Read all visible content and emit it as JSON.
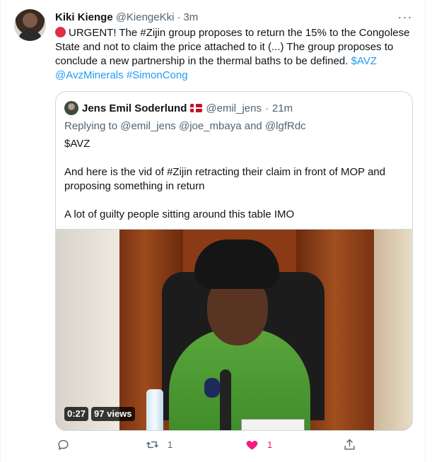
{
  "tweet": {
    "author_name": "Kiki Kienge",
    "author_handle": "@KiengeKki",
    "separator": "·",
    "time": "3m",
    "more_label": "···",
    "text_part1": "URGENT! The #Zijin group  proposes to return the 15% to the Congolese State and not to claim the price attached to it (...) The group proposes to conclude a new partnership in the thermal baths to be defined.",
    "link_cashtag": "$AVZ",
    "link_mention": "@AvzMinerals",
    "link_hashtag": "#SimonCong"
  },
  "quote": {
    "author_name": "Jens Emil Soderlund",
    "author_handle": "@emil_jens",
    "separator": "·",
    "time": "21m",
    "replying_to": "Replying to @emil_jens @joe_mbaya and @lgfRdc",
    "paragraphs": [
      "$AVZ",
      "And here is the vid of #Zijin retracting their claim in front of MOP and proposing something in return",
      "A lot of guilty people sitting around this table IMO"
    ],
    "video": {
      "duration": "0:27",
      "views": "97 views"
    }
  },
  "actions": {
    "reply": {
      "icon": "reply-icon",
      "count": ""
    },
    "retweet": {
      "icon": "retweet-icon",
      "count": "1"
    },
    "like": {
      "icon": "heart-icon",
      "count": "1",
      "color": "#f91880"
    },
    "share": {
      "icon": "share-icon",
      "count": ""
    }
  },
  "colors": {
    "link": "#1d9bf0",
    "secondary_text": "#536471",
    "border": "#cfd9de"
  }
}
